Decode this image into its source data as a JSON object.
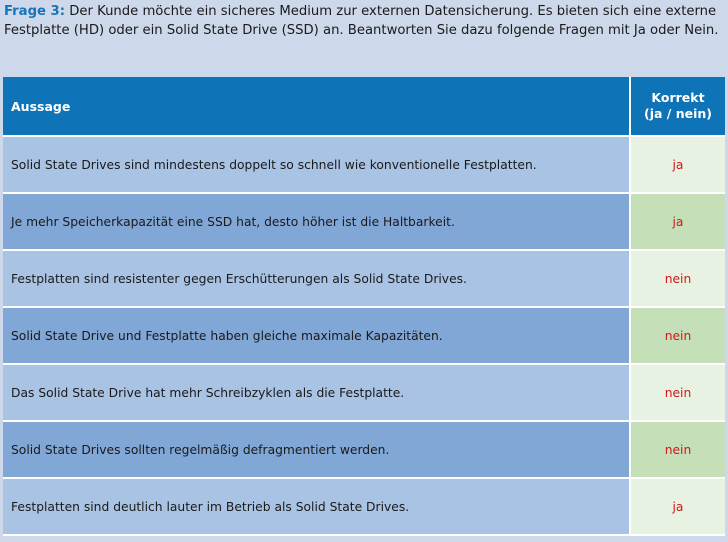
{
  "question": {
    "label": "Frage 3:",
    "text": " Der Kunde möchte ein sicheres Medium zur externen Datensicherung. Es bieten sich eine externe Festplatte (HD) oder ein Solid State Drive (SSD) an. Beantworten Sie dazu folgende Fragen mit Ja oder Nein."
  },
  "table": {
    "headers": {
      "statement": "Aussage",
      "answer_line1": "Korrekt",
      "answer_line2": "(ja / nein)"
    },
    "rows": [
      {
        "statement": "Solid State Drives sind mindestens doppelt so schnell wie konventionelle Festplatten.",
        "answer": "ja"
      },
      {
        "statement": "Je mehr Speicherkapazität eine SSD hat, desto höher ist die Haltbarkeit.",
        "answer": "ja"
      },
      {
        "statement": "Festplatten sind resistenter gegen Erschütterungen als Solid State Drives.",
        "answer": "nein"
      },
      {
        "statement": "Solid State Drive und Festplatte haben gleiche maximale Kapazitäten.",
        "answer": "nein"
      },
      {
        "statement": "Das Solid State Drive hat mehr Schreibzyklen als die Festplatte.",
        "answer": "nein"
      },
      {
        "statement": "Solid State Drives sollten regelmäßig defragmentiert werden.",
        "answer": "nein"
      },
      {
        "statement": "Festplatten sind deutlich lauter im Betrieb als Solid State Drives.",
        "answer": "ja"
      }
    ]
  },
  "colors": {
    "header_blue": "#0f73b8",
    "label_blue": "#1a73b8",
    "row_light": "#a9c3e4",
    "row_dark": "#80a7d6",
    "answer_light": "#e8f2e3",
    "answer_dark": "#c5dfb8",
    "answer_text": "#d01818"
  }
}
